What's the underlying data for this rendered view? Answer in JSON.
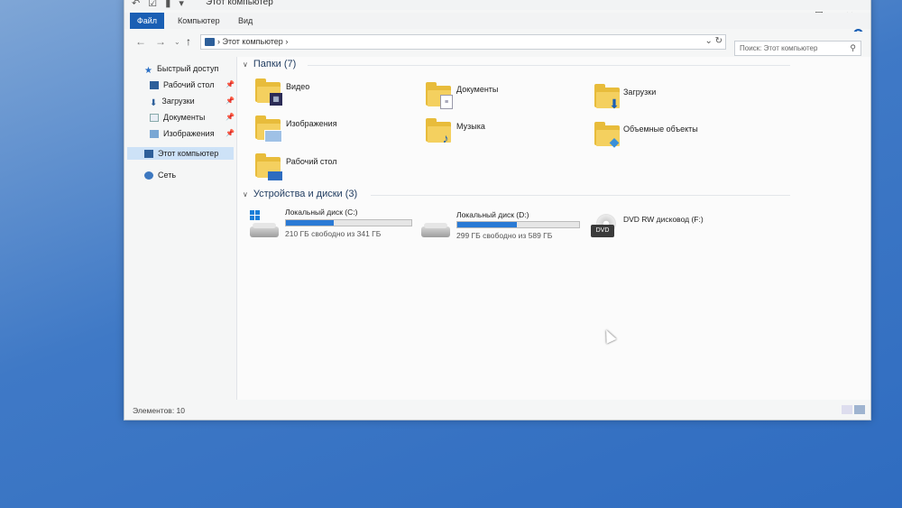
{
  "window": {
    "title": "Этот компьютер",
    "controls": [
      "—",
      "☐",
      "✕"
    ]
  },
  "ribbon": {
    "tabs": [
      "Файл",
      "Компьютер",
      "Вид"
    ],
    "help": "?"
  },
  "address_bar": {
    "path": "Этот компьютер",
    "search_placeholder": "Поиск: Этот компьютер"
  },
  "sidebar": {
    "items": [
      {
        "label": "Быстрый доступ",
        "icon": "star-icon"
      },
      {
        "label": "Рабочий стол",
        "icon": "desktop-icon",
        "pinned": true
      },
      {
        "label": "Загрузки",
        "icon": "download-icon",
        "pinned": true
      },
      {
        "label": "Документы",
        "icon": "documents-icon",
        "pinned": true
      },
      {
        "label": "Изображения",
        "icon": "pictures-icon",
        "pinned": true
      },
      {
        "label": "Этот компьютер",
        "icon": "computer-icon",
        "selected": true
      },
      {
        "label": "Сеть",
        "icon": "network-icon"
      }
    ]
  },
  "folders_group": {
    "title": "Папки (7)",
    "items": [
      {
        "label": "Видео",
        "icon": "video-folder-icon"
      },
      {
        "label": "Документы",
        "icon": "documents-folder-icon"
      },
      {
        "label": "Загрузки",
        "icon": "downloads-folder-icon"
      },
      {
        "label": "Изображения",
        "icon": "pictures-folder-icon"
      },
      {
        "label": "Музыка",
        "icon": "music-folder-icon"
      },
      {
        "label": "Объемные объекты",
        "icon": "3d-objects-folder-icon"
      },
      {
        "label": "Рабочий стол",
        "icon": "desktop-folder-icon"
      }
    ]
  },
  "devices_group": {
    "title": "Устройства и диски (3)",
    "drives": [
      {
        "label": "Локальный диск (C:)",
        "free_text": "210 ГБ свободно из 341 ГБ",
        "used_fraction": 0.38
      },
      {
        "label": "Локальный диск (D:)",
        "free_text": "299 ГБ свободно из 589 ГБ",
        "used_fraction": 0.49
      },
      {
        "label": "DVD RW дисковод (F:)",
        "free_text": "",
        "icon": "dvd-drive-icon"
      }
    ]
  },
  "statusbar": {
    "items_text": "Элементов: 10"
  },
  "colors": {
    "accent": "#1a5fb4",
    "folder": "#e8bc3b",
    "bar_fill": "#2a7ad5"
  }
}
